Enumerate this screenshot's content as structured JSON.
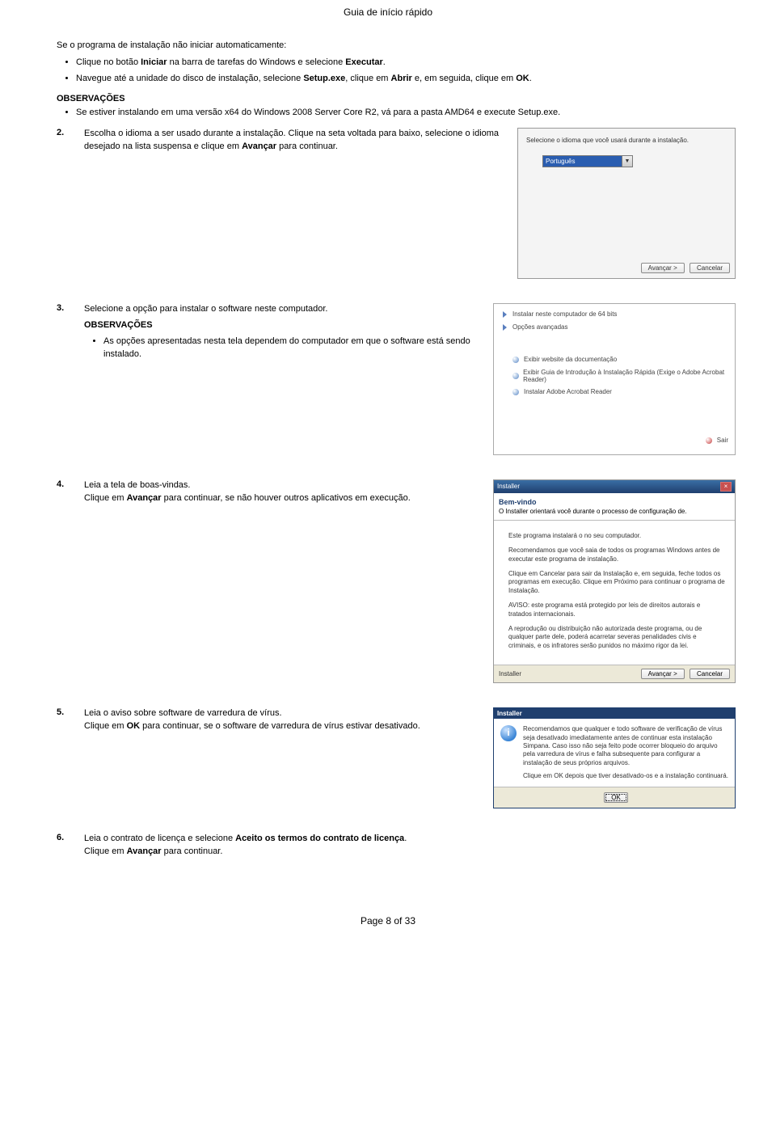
{
  "header": "Guia de início rápido",
  "footer": "Page 8 of 33",
  "intro": "Se o programa de instalação não iniciar automaticamente:",
  "intro_bullets": [
    {
      "pre": "Clique no botão ",
      "b1": "Iniciar",
      "mid": " na barra de tarefas do Windows e selecione ",
      "b2": "Executar",
      "post": "."
    },
    {
      "pre": "Navegue até a unidade do disco de instalação, selecione ",
      "b1": "Setup.exe",
      "mid": ", clique em ",
      "b2": "Abrir",
      "mid2": " e, em seguida, clique em ",
      "b3": "OK",
      "post": "."
    }
  ],
  "obs_title": "OBSERVAÇÕES",
  "obs1_bullet": "Se estiver instalando em uma versão x64 do Windows 2008 Server Core R2, vá para a pasta AMD64 e execute Setup.exe.",
  "step2": {
    "num": "2.",
    "text_pre": "Escolha o idioma a ser usado durante a instalação. Clique na seta voltada para baixo, selecione o idioma desejado na lista suspensa e clique em ",
    "text_b": "Avançar",
    "text_post": " para continuar."
  },
  "dlg2": {
    "label": "Selecione o idioma que você usará durante a instalação.",
    "selected": "Português",
    "btn_next": "Avançar >",
    "btn_cancel": "Cancelar"
  },
  "step3": {
    "num": "3.",
    "text": "Selecione a opção para instalar o software neste computador.",
    "obs_bullet": "As opções apresentadas nesta tela dependem do computador em que o software está sendo instalado."
  },
  "opt3": {
    "l1": "Instalar neste computador de 64 bits",
    "l2": "Opções avançadas",
    "s1": "Exibir website da documentação",
    "s2": "Exibir Guia de Introdução à Instalação Rápida (Exige o Adobe Acrobat Reader)",
    "s3": "Instalar Adobe Acrobat Reader",
    "exit": "Sair"
  },
  "step4": {
    "num": "4.",
    "text": "Leia a tela de boas-vindas.",
    "line2_pre": "Clique em ",
    "line2_b": "Avançar",
    "line2_post": " para continuar, se não houver outros aplicativos em execução."
  },
  "wiz4": {
    "title": "Installer",
    "h": "Bem-vindo",
    "sub": "O Installer orientará você durante o processo de configuração de.",
    "p1": "Este programa instalará o no seu computador.",
    "p2": "Recomendamos que você saia de todos os programas Windows antes de executar este programa de instalação.",
    "p3": "Clique em Cancelar para sair da Instalação e, em seguida, feche todos os programas em execução. Clique em Próximo para continuar o programa de Instalação.",
    "p4": "AVISO: este programa está protegido por leis de direitos autorais e tratados internacionais.",
    "p5": "A reprodução ou distribuição não autorizada deste programa, ou de qualquer parte dele, poderá acarretar severas penalidades civis e criminais, e os infratores serão punidos no máximo rigor da lei.",
    "foot_label": "Installer",
    "btn_next": "Avançar >",
    "btn_cancel": "Cancelar"
  },
  "step5": {
    "num": "5.",
    "text": "Leia o aviso sobre software de varredura de vírus.",
    "line2_pre": "Clique em ",
    "line2_b": "OK",
    "line2_post": " para continuar, se o software de varredura de vírus estivar desativado."
  },
  "warn5": {
    "title": "Installer",
    "p1": "Recomendamos que qualquer e todo software de verificação de vírus seja desativado imediatamente antes de continuar esta instalação Simpana. Caso isso não seja feito pode ocorrer bloqueio do arquivo pela varredura de vírus e falha subsequente para configurar a instalação de seus próprios arquivos.",
    "p2": "Clique em OK depois que tiver desativado-os e a instalação continuará.",
    "btn_ok": "OK"
  },
  "step6": {
    "num": "6.",
    "text_pre": "Leia o contrato de licença e selecione ",
    "text_b": "Aceito os termos do contrato de licença",
    "text_post": ".",
    "line2_pre": "Clique em ",
    "line2_b": "Avançar",
    "line2_post": " para continuar."
  }
}
